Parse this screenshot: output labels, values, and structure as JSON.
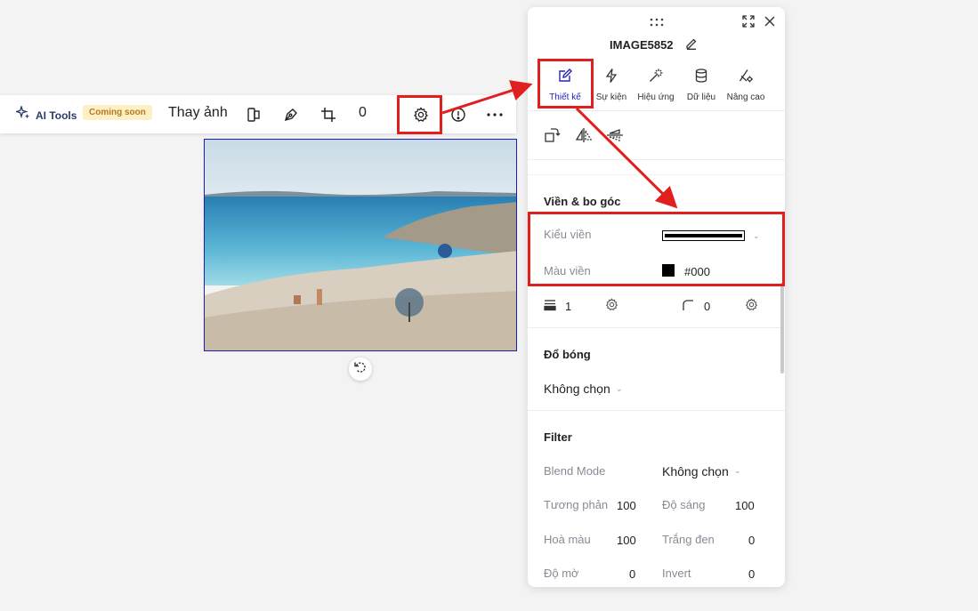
{
  "toolbar": {
    "ai_tools_label": "AI Tools",
    "coming_soon_badge": "Coming soon",
    "replace_label": "Thay ảnh",
    "value": "0"
  },
  "panel": {
    "title": "IMAGE5852",
    "tabs": [
      {
        "label": "Thiết kế",
        "icon": "pencil-edit-icon"
      },
      {
        "label": "Sự kiện",
        "icon": "lightning-icon"
      },
      {
        "label": "Hiệu ứng",
        "icon": "magic-wand-icon"
      },
      {
        "label": "Dữ liệu",
        "icon": "database-icon"
      },
      {
        "label": "Nâng cao",
        "icon": "advanced-settings-icon"
      }
    ],
    "border": {
      "section_title": "Viền & bo góc",
      "style_label": "Kiểu viền",
      "color_label": "Màu viền",
      "color_value": "#000",
      "width_value": "1",
      "radius_value": "0"
    },
    "shadow": {
      "section_title": "Đổ bóng",
      "value": "Không chọn"
    },
    "filter": {
      "section_title": "Filter",
      "blend_mode_label": "Blend Mode",
      "blend_mode_value": "Không chọn",
      "contrast_label": "Tương phản",
      "contrast_value": "100",
      "brightness_label": "Độ sáng",
      "brightness_value": "100",
      "saturation_label": "Hoà màu",
      "saturation_value": "100",
      "grayscale_label": "Trắng đen",
      "grayscale_value": "0",
      "blur_label": "Độ mờ",
      "blur_value": "0",
      "invert_label": "Invert",
      "invert_value": "0"
    }
  },
  "colors": {
    "accent": "#2323b8",
    "annotation_red": "#e21f1f",
    "badge_bg": "#fdf0c4",
    "badge_text": "#b7791f"
  }
}
